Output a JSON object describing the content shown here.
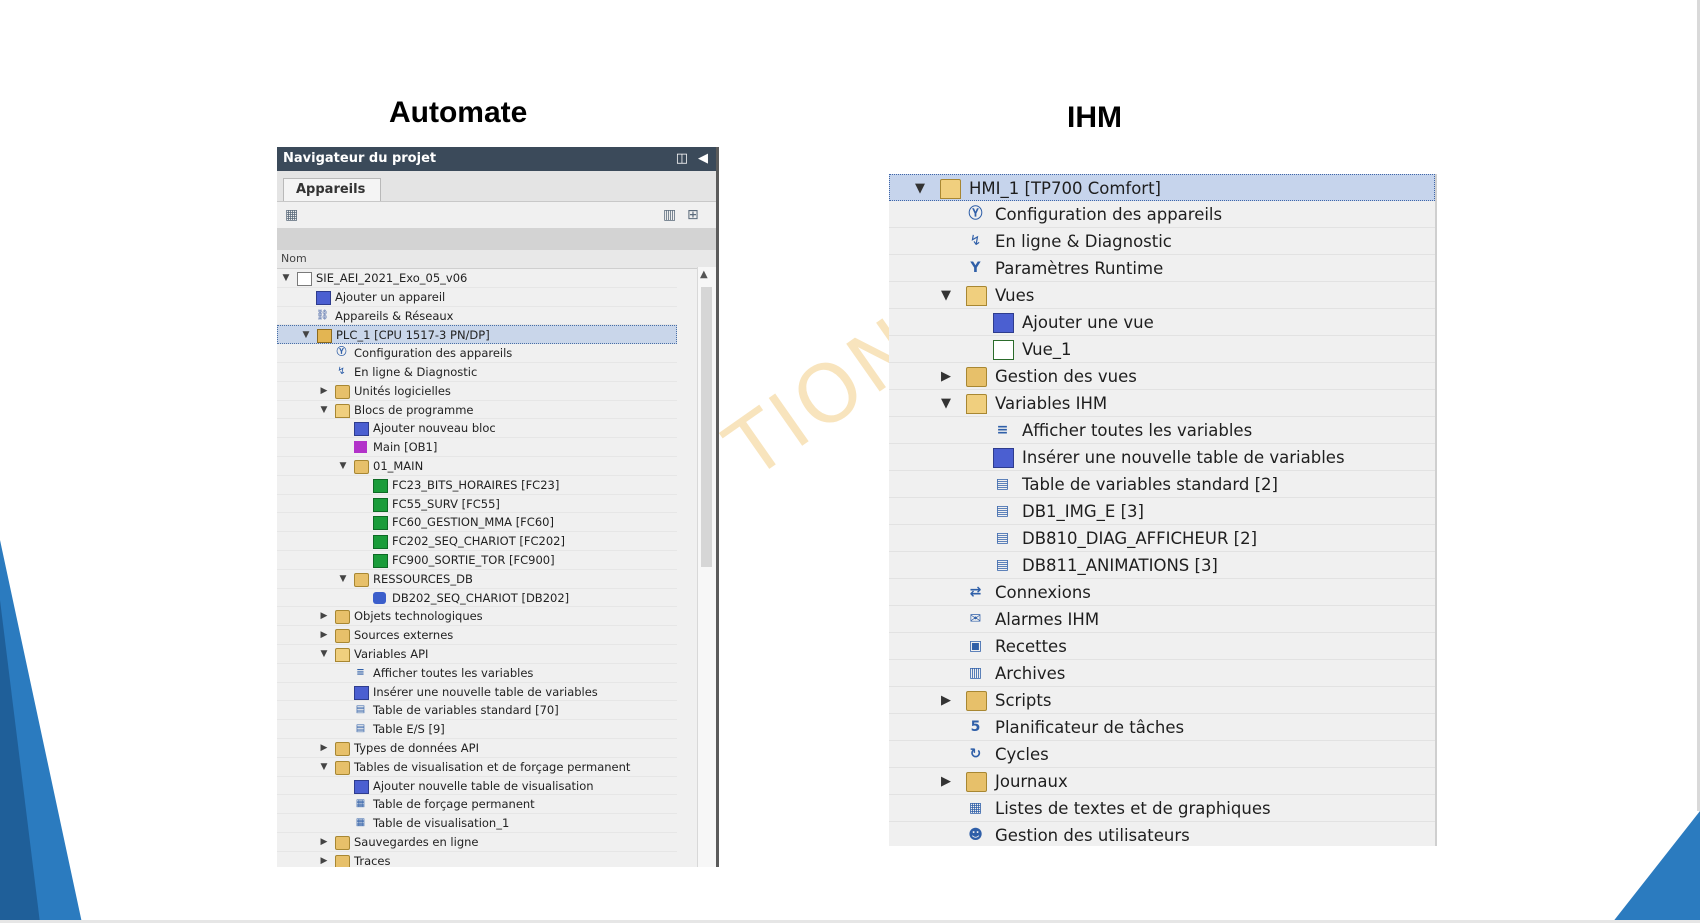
{
  "headings": {
    "left": "Automate",
    "right": "IHM"
  },
  "watermark": "TION C",
  "navigator": {
    "title": "Navigateur du projet",
    "tab": "Appareils",
    "column_name": "Nom",
    "rows": [
      {
        "label": "SIE_AEI_2021_Exo_05_v06",
        "level": 0,
        "arrow": "down",
        "icon": "project-icon"
      },
      {
        "label": "Ajouter un appareil",
        "level": 1,
        "arrow": "",
        "icon": "add-device-icon"
      },
      {
        "label": "Appareils & Réseaux",
        "level": 1,
        "arrow": "",
        "icon": "network-icon"
      },
      {
        "label": "PLC_1 [CPU 1517-3 PN/DP]",
        "level": 1,
        "arrow": "down",
        "icon": "cpu-icon",
        "selected": true
      },
      {
        "label": "Configuration des appareils",
        "level": 2,
        "arrow": "",
        "icon": "device-config-icon"
      },
      {
        "label": "En ligne & Diagnostic",
        "level": 2,
        "arrow": "",
        "icon": "online-diagnostic-icon"
      },
      {
        "label": "Unités logicielles",
        "level": 2,
        "arrow": "right",
        "icon": "software-units-icon"
      },
      {
        "label": "Blocs de programme",
        "level": 2,
        "arrow": "down",
        "icon": "folder-open-icon"
      },
      {
        "label": "Ajouter nouveau bloc",
        "level": 3,
        "arrow": "",
        "icon": "add-block-icon"
      },
      {
        "label": "Main [OB1]",
        "level": 3,
        "arrow": "",
        "icon": "ob-icon"
      },
      {
        "label": "01_MAIN",
        "level": 3,
        "arrow": "down",
        "icon": "group-folder-icon"
      },
      {
        "label": "FC23_BITS_HORAIRES [FC23]",
        "level": 4,
        "arrow": "",
        "icon": "fc-block-icon"
      },
      {
        "label": "FC55_SURV [FC55]",
        "level": 4,
        "arrow": "",
        "icon": "fc-block-icon"
      },
      {
        "label": "FC60_GESTION_MMA [FC60]",
        "level": 4,
        "arrow": "",
        "icon": "fc-block-icon"
      },
      {
        "label": "FC202_SEQ_CHARIOT [FC202]",
        "level": 4,
        "arrow": "",
        "icon": "fc-block-icon"
      },
      {
        "label": "FC900_SORTIE_TOR [FC900]",
        "level": 4,
        "arrow": "",
        "icon": "fc-block-icon"
      },
      {
        "label": "RESSOURCES_DB",
        "level": 3,
        "arrow": "down",
        "icon": "group-folder-icon"
      },
      {
        "label": "DB202_SEQ_CHARIOT [DB202]",
        "level": 4,
        "arrow": "",
        "icon": "db-icon"
      },
      {
        "label": "Objets technologiques",
        "level": 2,
        "arrow": "right",
        "icon": "tech-objects-icon"
      },
      {
        "label": "Sources externes",
        "level": 2,
        "arrow": "right",
        "icon": "external-sources-icon"
      },
      {
        "label": "Variables API",
        "level": 2,
        "arrow": "down",
        "icon": "folder-open-icon"
      },
      {
        "label": "Afficher toutes les variables",
        "level": 3,
        "arrow": "",
        "icon": "show-variables-icon"
      },
      {
        "label": "Insérer une nouvelle table de variables",
        "level": 3,
        "arrow": "",
        "icon": "add-table-icon"
      },
      {
        "label": "Table de variables standard [70]",
        "level": 3,
        "arrow": "",
        "icon": "variable-table-icon"
      },
      {
        "label": "Table E/S [9]",
        "level": 3,
        "arrow": "",
        "icon": "variable-table-icon"
      },
      {
        "label": "Types de données API",
        "level": 2,
        "arrow": "right",
        "icon": "data-types-icon"
      },
      {
        "label": "Tables de visualisation et de forçage permanent",
        "level": 2,
        "arrow": "down",
        "icon": "watch-tables-icon"
      },
      {
        "label": "Ajouter nouvelle table de visualisation",
        "level": 3,
        "arrow": "",
        "icon": "add-table-icon"
      },
      {
        "label": "Table de forçage permanent",
        "level": 3,
        "arrow": "",
        "icon": "force-table-icon"
      },
      {
        "label": "Table de visualisation_1",
        "level": 3,
        "arrow": "",
        "icon": "watch-table-icon"
      },
      {
        "label": "Sauvegardes en ligne",
        "level": 2,
        "arrow": "right",
        "icon": "online-backups-icon"
      },
      {
        "label": "Traces",
        "level": 2,
        "arrow": "right",
        "icon": "traces-icon"
      }
    ]
  },
  "hmi": {
    "rows": [
      {
        "label": "HMI_1 [TP700 Comfort]",
        "level": 0,
        "arrow": "down",
        "icon": "hmi-device-icon",
        "selected": true
      },
      {
        "label": "Configuration des appareils",
        "level": 1,
        "arrow": "",
        "icon": "device-config-icon"
      },
      {
        "label": "En ligne & Diagnostic",
        "level": 1,
        "arrow": "",
        "icon": "online-diagnostic-icon"
      },
      {
        "label": "Paramètres Runtime",
        "level": 1,
        "arrow": "",
        "icon": "runtime-settings-icon"
      },
      {
        "label": "Vues",
        "level": 1,
        "arrow": "down",
        "icon": "folder-open-icon"
      },
      {
        "label": "Ajouter une vue",
        "level": 2,
        "arrow": "",
        "icon": "add-view-icon"
      },
      {
        "label": "Vue_1",
        "level": 2,
        "arrow": "",
        "icon": "view-icon"
      },
      {
        "label": "Gestion des vues",
        "level": 1,
        "arrow": "right",
        "icon": "screen-management-icon"
      },
      {
        "label": "Variables IHM",
        "level": 1,
        "arrow": "down",
        "icon": "folder-open-icon"
      },
      {
        "label": "Afficher toutes les variables",
        "level": 2,
        "arrow": "",
        "icon": "show-variables-icon"
      },
      {
        "label": "Insérer une nouvelle table de variables",
        "level": 2,
        "arrow": "",
        "icon": "add-table-icon"
      },
      {
        "label": "Table de variables standard [2]",
        "level": 2,
        "arrow": "",
        "icon": "variable-table-icon"
      },
      {
        "label": "DB1_IMG_E [3]",
        "level": 2,
        "arrow": "",
        "icon": "variable-table-icon"
      },
      {
        "label": "DB810_DIAG_AFFICHEUR [2]",
        "level": 2,
        "arrow": "",
        "icon": "variable-table-icon"
      },
      {
        "label": "DB811_ANIMATIONS [3]",
        "level": 2,
        "arrow": "",
        "icon": "variable-table-icon"
      },
      {
        "label": "Connexions",
        "level": 1,
        "arrow": "",
        "icon": "connections-icon"
      },
      {
        "label": "Alarmes IHM",
        "level": 1,
        "arrow": "",
        "icon": "alarms-icon"
      },
      {
        "label": "Recettes",
        "level": 1,
        "arrow": "",
        "icon": "recipes-icon"
      },
      {
        "label": "Archives",
        "level": 1,
        "arrow": "",
        "icon": "archives-icon"
      },
      {
        "label": "Scripts",
        "level": 1,
        "arrow": "right",
        "icon": "scripts-icon"
      },
      {
        "label": "Planificateur de tâches",
        "level": 1,
        "arrow": "",
        "icon": "scheduler-icon"
      },
      {
        "label": "Cycles",
        "level": 1,
        "arrow": "",
        "icon": "cycles-icon"
      },
      {
        "label": "Journaux",
        "level": 1,
        "arrow": "right",
        "icon": "reports-icon"
      },
      {
        "label": "Listes de textes et de graphiques",
        "level": 1,
        "arrow": "",
        "icon": "text-graphic-lists-icon"
      },
      {
        "label": "Gestion des utilisateurs",
        "level": 1,
        "arrow": "",
        "icon": "user-admin-icon"
      }
    ]
  },
  "colors": {
    "accent_blue": "#2b7bbf",
    "titlebar": "#3b4a5a",
    "selection": "#c9d6ea",
    "watermark": "#f6dca8"
  }
}
